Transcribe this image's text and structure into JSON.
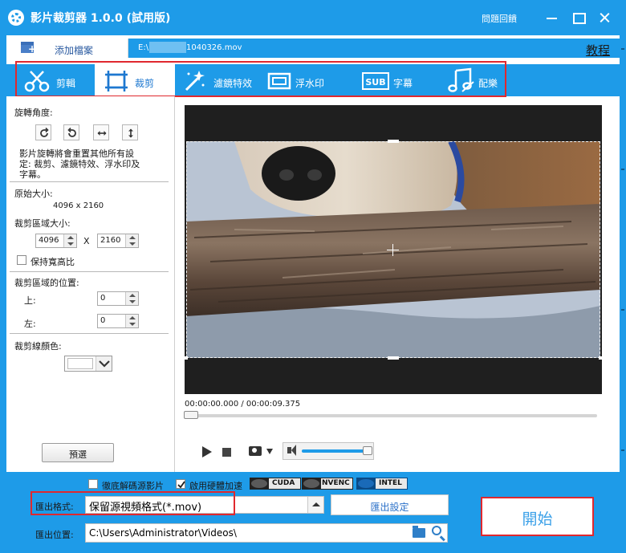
{
  "window": {
    "title": "影片裁剪器 1.0.0 (試用版)",
    "feedback_label": "問題回饋"
  },
  "file_row": {
    "add_file_label": "添加檔案",
    "file_prefix": "E:\\",
    "file_suffix": "1040326.mov",
    "tutorial_label": "教程"
  },
  "tabs": [
    {
      "id": "edit",
      "label": "剪輯",
      "icon": "scissors-icon"
    },
    {
      "id": "crop",
      "label": "裁剪",
      "icon": "crop-icon",
      "active": true
    },
    {
      "id": "filter",
      "label": "濾鏡特效",
      "icon": "magic-wand-icon"
    },
    {
      "id": "watermark",
      "label": "浮水印",
      "icon": "watermark-icon"
    },
    {
      "id": "subtitle",
      "label": "字幕",
      "icon": "subtitle-icon"
    },
    {
      "id": "music",
      "label": "配樂",
      "icon": "music-note-icon"
    }
  ],
  "left_panel": {
    "rotation_label": "旋轉角度:",
    "rotation_note": [
      "影片旋轉將會重置其他所有設",
      "定: 裁剪、濾鏡特效、浮水印及",
      "字幕。"
    ],
    "original_size_label": "原始大小:",
    "original_size_value": "4096 x 2160",
    "crop_area_label": "裁剪區域大小:",
    "crop_width": "4096",
    "crop_x_label": "X",
    "crop_height": "2160",
    "keep_ratio_label": "保持寬高比",
    "position_label": "裁剪區域的位置:",
    "top_label": "上:",
    "top_value": "0",
    "left_label": "左:",
    "left_value": "0",
    "line_color_label": "裁剪線顏色:",
    "preset_label": "預選"
  },
  "player": {
    "time_readout": "00:00:00.000 / 00:00:09.375"
  },
  "bottom": {
    "full_decode_label": "徹底解碼源影片",
    "hw_accel_label": "啟用硬體加速",
    "gpu_badges": [
      "CUDA",
      "NVENC",
      "INTEL"
    ],
    "format_label": "匯出格式:",
    "format_value": "保留源視頻格式(*.mov)",
    "export_settings_label": "匯出設定",
    "path_label": "匯出位置:",
    "path_value": "C:\\Users\\Administrator\\Videos\\",
    "start_label": "開始"
  },
  "colors": {
    "accent": "#1e9be8",
    "highlight": "#e0282e"
  }
}
